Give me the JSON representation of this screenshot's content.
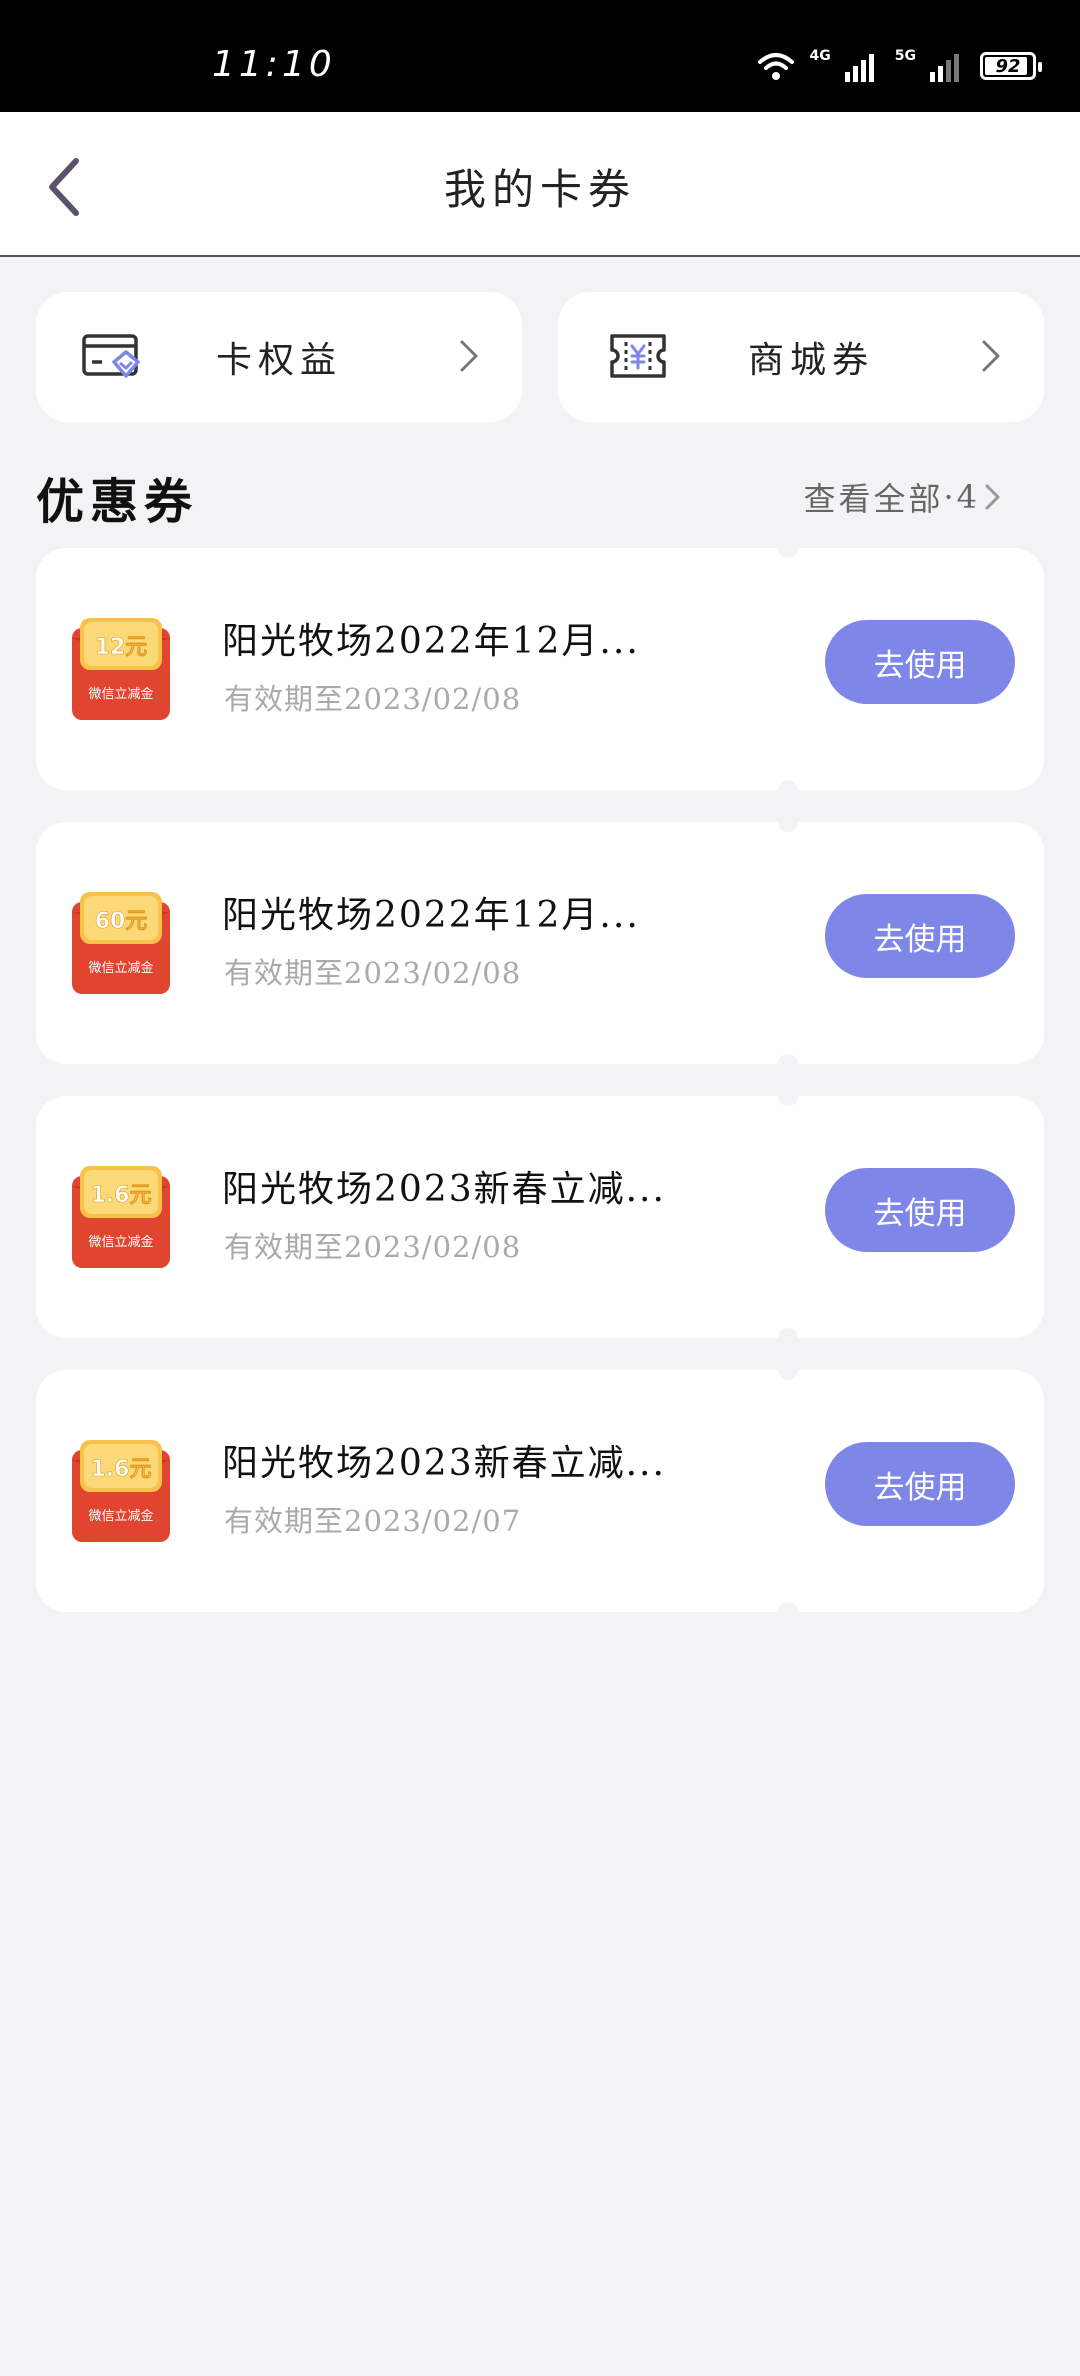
{
  "status_bar": {
    "time": "11:10",
    "network_1": "4G",
    "network_2": "5G",
    "battery": "92",
    "battery_level_percent": 92
  },
  "nav": {
    "title": "我的卡券",
    "back_icon": "chevron-left-icon"
  },
  "entries": [
    {
      "label": "卡权益",
      "icon": "card-benefit-icon"
    },
    {
      "label": "商城券",
      "icon": "yuan-ticket-icon"
    }
  ],
  "section": {
    "title": "优惠券",
    "view_all": "查看全部",
    "count": "4"
  },
  "coupons": [
    {
      "badge_value": "12元",
      "badge_caption": "微信立减金",
      "title": "阳光牧场2022年12月...",
      "expiry": "有效期至2023/02/08",
      "button": "去使用"
    },
    {
      "badge_value": "60元",
      "badge_caption": "微信立减金",
      "title": "阳光牧场2022年12月...",
      "expiry": "有效期至2023/02/08",
      "button": "去使用"
    },
    {
      "badge_value": "1.6元",
      "badge_caption": "微信立减金",
      "title": "阳光牧场2023新春立减...",
      "expiry": "有效期至2023/02/08",
      "button": "去使用"
    },
    {
      "badge_value": "1.6元",
      "badge_caption": "微信立减金",
      "title": "阳光牧场2023新春立减...",
      "expiry": "有效期至2023/02/07",
      "button": "去使用"
    }
  ],
  "colors": {
    "accent_button": "#7e86e8",
    "page_background": "#f2f3f5",
    "badge_red": "#e0452f",
    "badge_gold": "#f7c24a"
  }
}
